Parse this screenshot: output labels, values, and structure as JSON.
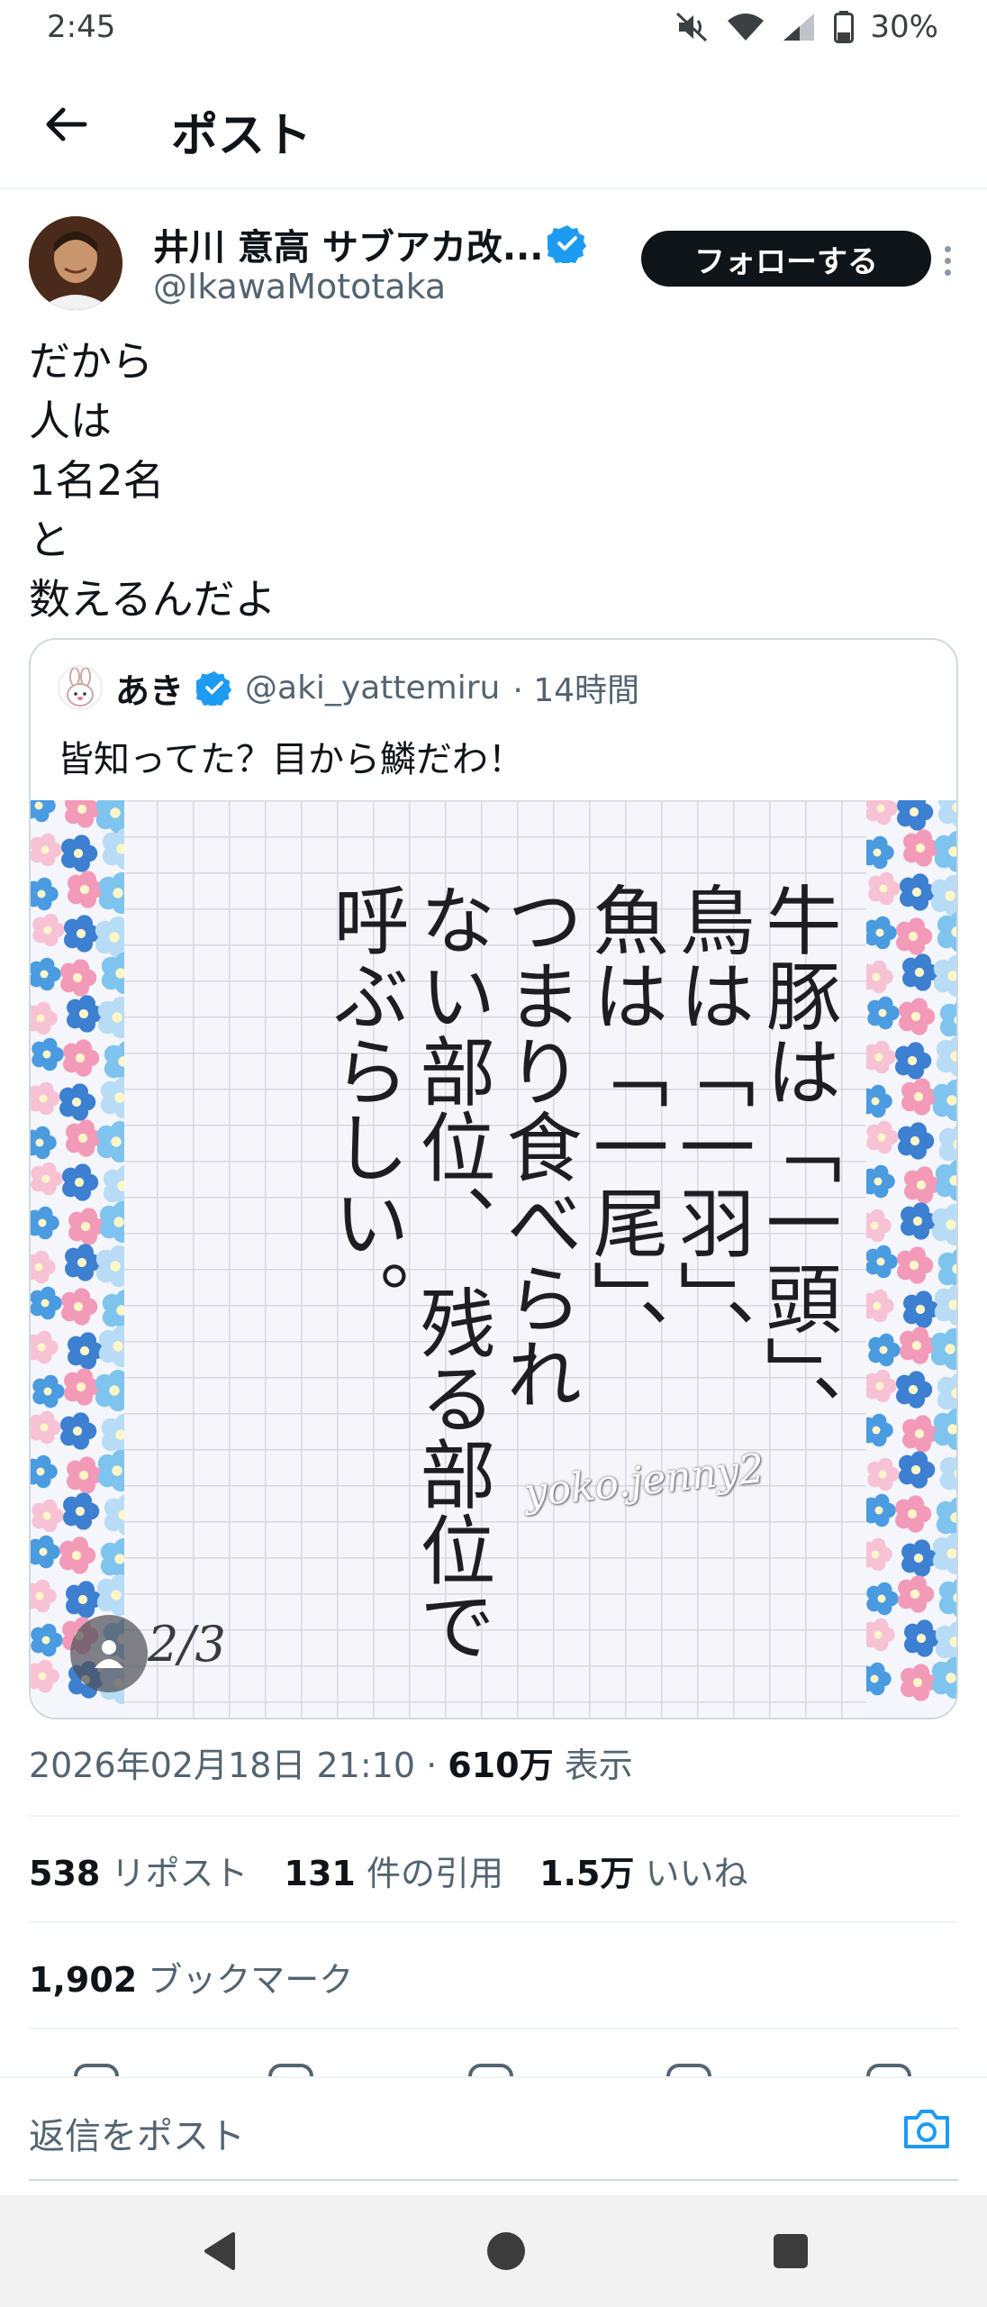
{
  "status_bar": {
    "time": "2:45",
    "battery": "30%"
  },
  "header": {
    "title": "ポスト"
  },
  "author": {
    "name": "井川 意高 サブアカ改...",
    "handle": "@IkawaMototaka",
    "follow_label": "フォローする"
  },
  "post": {
    "text": "だから\n人は\n1名2名\nと\n数えるんだよ"
  },
  "quote": {
    "name": "あき",
    "handle": "@aki_yattemiru",
    "time": "· 14時間",
    "text": "皆知ってた？目から鱗だわ！",
    "image": {
      "columns": [
        "牛豚は「一頭」、",
        "鳥は「一羽」、",
        "魚は「一尾」、",
        "つまり食べられ",
        "ない部位、",
        "残る部位で",
        "呼ぶらしい。"
      ],
      "signature": "yoko.jenny2",
      "page_indicator": "2/3"
    }
  },
  "meta": {
    "date": "2026年02月18日 21:10",
    "dot": "·",
    "views_count": "610万",
    "views_label": "表示"
  },
  "stats": {
    "reposts_count": "538",
    "reposts_label": "リポスト",
    "quotes_count": "131",
    "quotes_label": "件の引用",
    "likes_count": "1.5万",
    "likes_label": "いいね",
    "bookmarks_count": "1,902",
    "bookmarks_label": "ブックマーク"
  },
  "reply": {
    "placeholder": "返信をポスト"
  },
  "colors": {
    "accent": "#1d9bf0",
    "text_primary": "#0f1419",
    "text_secondary": "#536471",
    "follow_bg": "#0f1419"
  },
  "icons": [
    "back-arrow-icon",
    "mute-icon",
    "wifi-icon",
    "signal-icon",
    "battery-icon",
    "verified-icon",
    "more-icon",
    "person-icon",
    "camera-icon",
    "nav-back-icon",
    "nav-home-icon",
    "nav-recents-icon"
  ]
}
